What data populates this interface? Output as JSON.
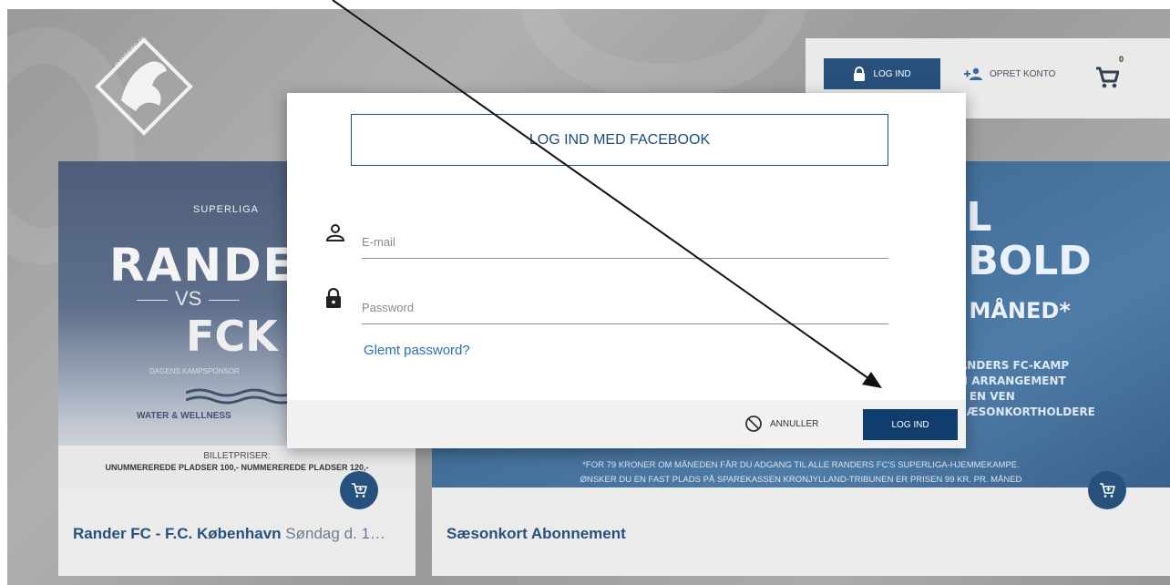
{
  "header": {
    "login_label": "LOG IND",
    "create_account_label": "OPRET KONTO",
    "cart_count": "0"
  },
  "logo": {
    "text": "RANDERS FC"
  },
  "cards": [
    {
      "poster": {
        "league": "SUPERLIGA",
        "home": "RANDERS",
        "vs": "VS",
        "away": "FCK",
        "sponsor_label": "DAGENS KAMPSPONSOR",
        "sponsor": "WATER & WELLNESS",
        "prices_heading": "BILLETPRISER:",
        "prices": "UNUMMEREREDE PLADSER 100,-  NUMMEREREDE PLADSER 120,-"
      },
      "title_bold": "Rander FC - F.C. København",
      "title_rest": " Søndag d. 1…"
    },
    {
      "poster": {
        "line1": "IL",
        "line2": "-BOLD",
        "line3": ". MÅNED*",
        "line4": "ANDERS FC-KAMP",
        "line5": "N ARRANGEMENT",
        "line6": "L EN VEN",
        "line7": "SÆSONKORTHOLDERE",
        "foot1": "*FOR 79 KRONER OM MÅNEDEN FÅR DU ADGANG TIL ALLE RANDERS FC'S SUPERLIGA-HJEMMEKAMPE.",
        "foot2": "ØNSKER DU EN FAST PLADS PÅ SPAREKASSEN KRONJYLLAND-TRIBUNEN ER PRISEN 99 KR. PR. MÅNED"
      },
      "title_bold": "Sæsonkort Abonnement"
    }
  ],
  "modal": {
    "facebook_label": "LOG IND MED FACEBOOK",
    "email_placeholder": "E-mail",
    "password_placeholder": "Password",
    "forgot_label": "Glemt password?",
    "cancel_label": "ANNULLER",
    "login_label": "LOG IND"
  },
  "colors": {
    "primary": "#0f3e6e",
    "link": "#2f6fb0"
  }
}
